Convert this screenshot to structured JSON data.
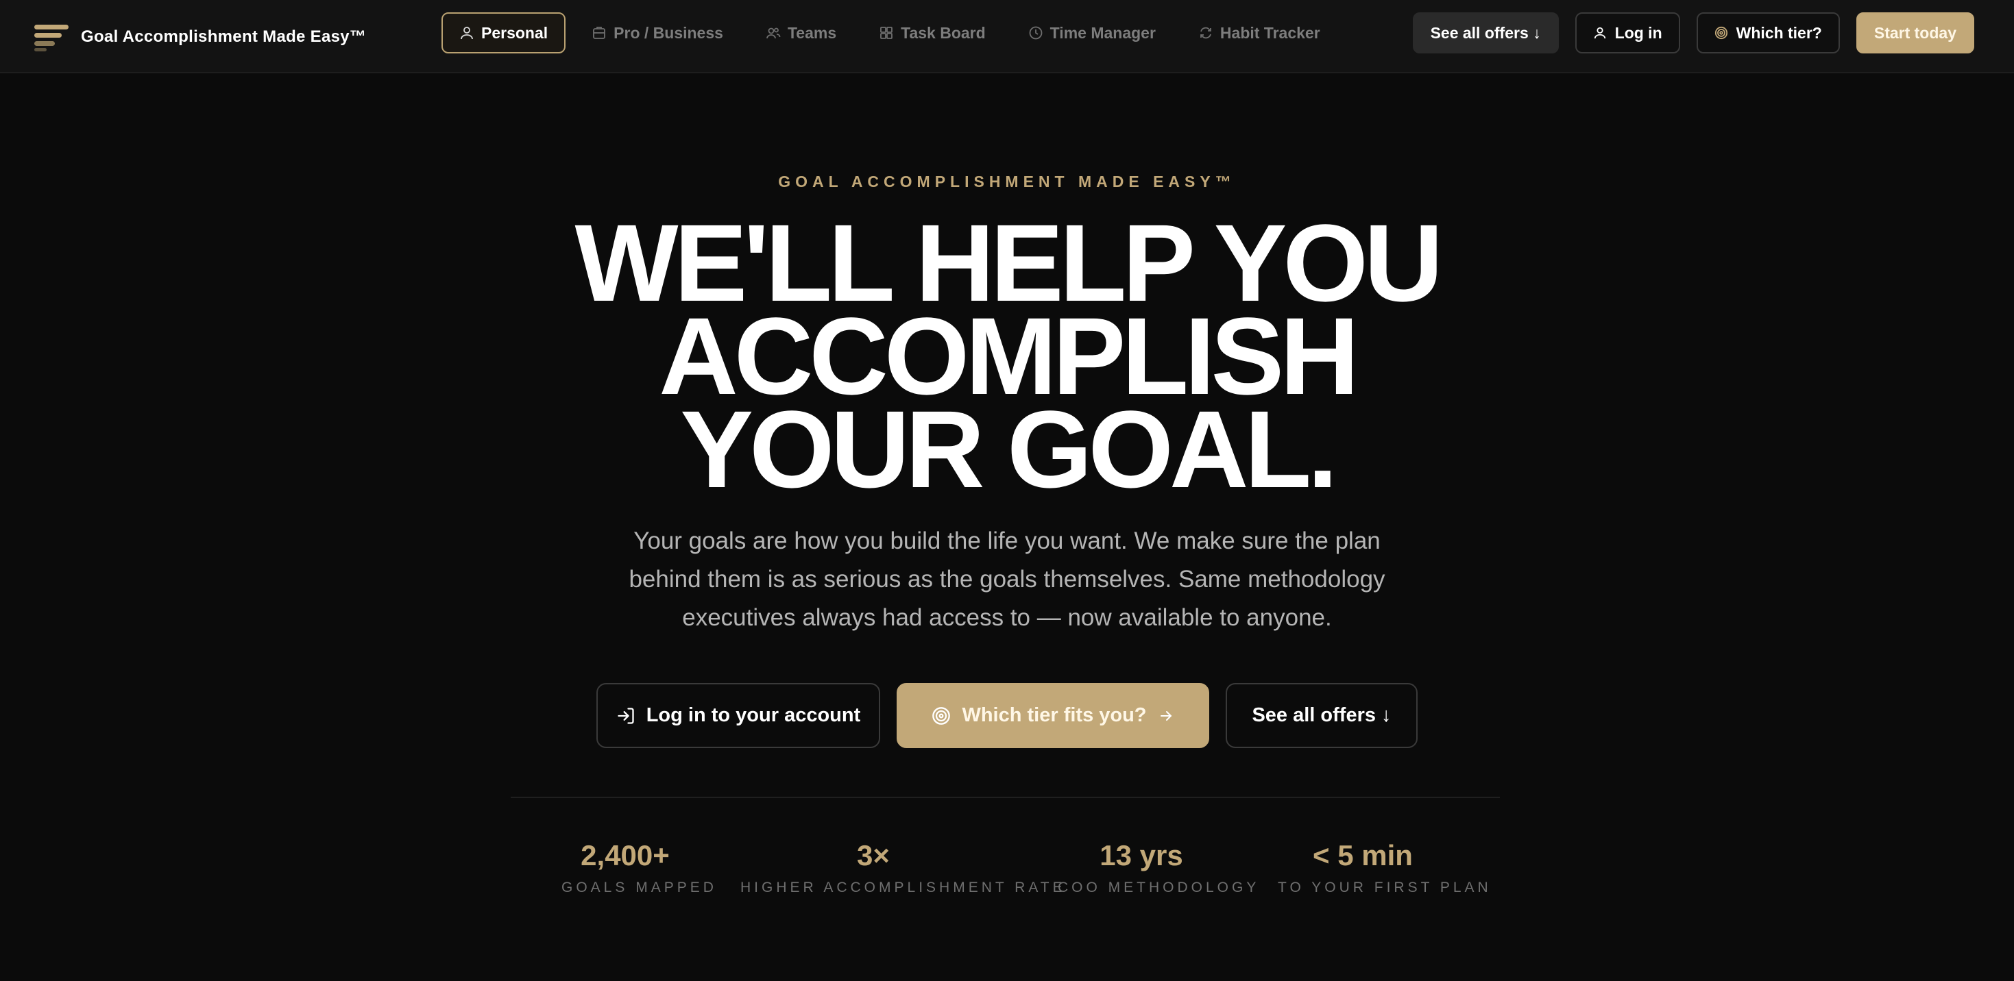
{
  "brand": {
    "name": "Goal Accomplishment Made Easy™"
  },
  "nav": {
    "tabs": [
      {
        "label": "Personal",
        "icon": "user-icon",
        "active": true
      },
      {
        "label": "Pro / Business",
        "icon": "building-icon",
        "active": false
      },
      {
        "label": "Teams",
        "icon": "users-icon",
        "active": false
      },
      {
        "label": "Task Board",
        "icon": "grid-icon",
        "active": false
      },
      {
        "label": "Time Manager",
        "icon": "clock-icon",
        "active": false
      },
      {
        "label": "Habit Tracker",
        "icon": "repeat-icon",
        "active": false
      }
    ]
  },
  "actions": {
    "offers": "See all offers ↓",
    "login": "Log in",
    "tier": "Which tier?",
    "start": "Start today"
  },
  "hero": {
    "eyebrow": "GOAL ACCOMPLISHMENT MADE EASY™",
    "line1": "WE'LL HELP YOU",
    "line2": "ACCOMPLISH",
    "line3": "YOUR GOAL.",
    "subtext": "Your goals are how you build the life you want. We make sure the plan behind them is as serious as the goals themselves. Same methodology executives always had access to — now available to anyone."
  },
  "ctas": {
    "login": "Log in to your account",
    "tier": "Which tier fits you?",
    "offers": "See all offers ↓"
  },
  "stats": [
    {
      "value": "2,400+",
      "label": "GOALS MAPPED"
    },
    {
      "value": "3×",
      "label": "HIGHER ACCOMPLISHMENT RATE"
    },
    {
      "value": "13 yrs",
      "label": "COO METHODOLOGY"
    },
    {
      "value": "< 5 min",
      "label": "TO YOUR FIRST PLAN"
    }
  ],
  "colors": {
    "accent": "#c2a878",
    "background": "#0b0b0b",
    "muted_text": "#b5b5b5"
  }
}
